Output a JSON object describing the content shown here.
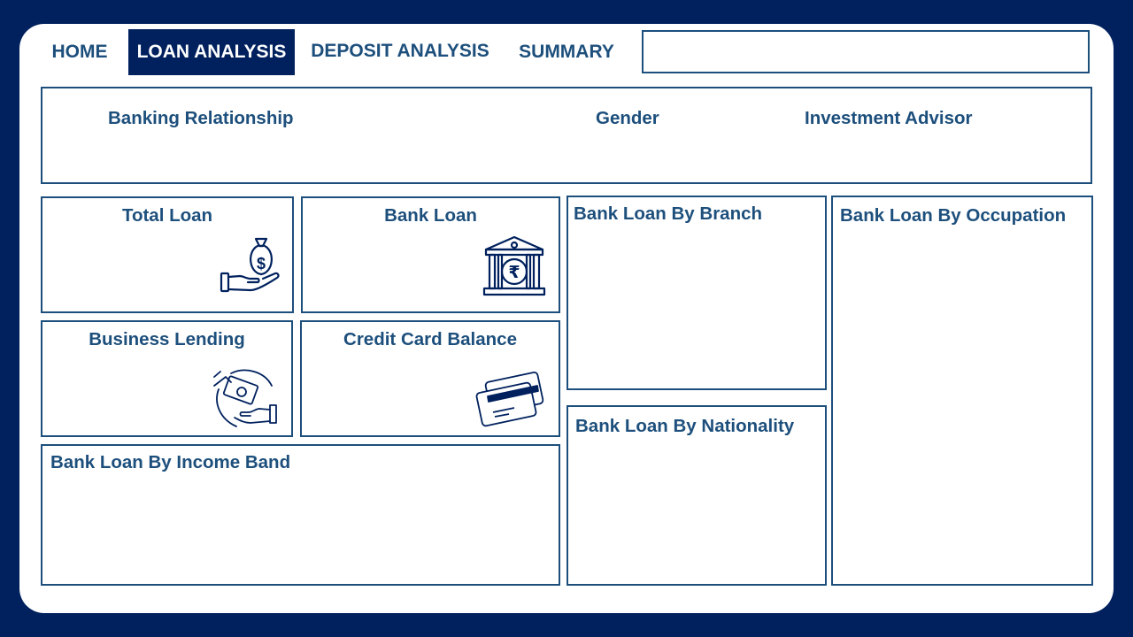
{
  "nav": {
    "tabs": [
      {
        "label": "HOME",
        "active": false
      },
      {
        "label": "LOAN ANALYSIS",
        "active": true
      },
      {
        "label": "DEPOSIT ANALYSIS",
        "active": false
      },
      {
        "label": "SUMMARY",
        "active": false
      }
    ],
    "search": {
      "value": "",
      "placeholder": ""
    }
  },
  "filters": {
    "banking_relationship": "Banking Relationship",
    "gender": "Gender",
    "investment_advisor": "Investment Advisor"
  },
  "kpis": {
    "total_loan": {
      "title": "Total Loan",
      "icon": "money-bag-hand-icon"
    },
    "bank_loan": {
      "title": "Bank Loan",
      "icon": "bank-rupee-icon"
    },
    "business_lending": {
      "title": "Business Lending",
      "icon": "cash-exchange-icon"
    },
    "credit_card_balance": {
      "title": "Credit Card Balance",
      "icon": "credit-card-icon"
    }
  },
  "charts": {
    "by_branch": "Bank Loan By Branch",
    "by_occupation": "Bank Loan By Occupation",
    "by_nationality": "Bank Loan By Nationality",
    "by_income_band": "Bank Loan By Income Band"
  },
  "colors": {
    "background": "#00215e",
    "accent": "#1d4f7c",
    "active_tab": "#00215e",
    "canvas": "#ffffff"
  }
}
